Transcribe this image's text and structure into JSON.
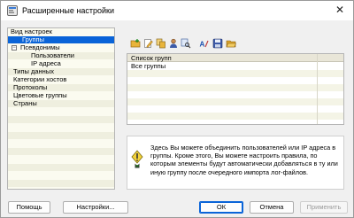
{
  "window": {
    "title": "Расширенные настройки",
    "close_glyph": "✕",
    "icon": "settings-window-icon"
  },
  "tree": {
    "items": [
      {
        "label": "Вид настроек",
        "level": 0,
        "expander": "",
        "selected": false
      },
      {
        "label": "Группы",
        "level": 1,
        "expander": "",
        "selected": true
      },
      {
        "label": "Псевдонимы",
        "level": 0,
        "expander": "−",
        "selected": false
      },
      {
        "label": "Пользователи",
        "level": 2,
        "expander": "",
        "selected": false
      },
      {
        "label": "IP адреса",
        "level": 2,
        "expander": "",
        "selected": false
      },
      {
        "label": "Типы данных",
        "level": 1,
        "expander": "",
        "selected": false
      },
      {
        "label": "Категории хостов",
        "level": 1,
        "expander": "",
        "selected": false
      },
      {
        "label": "Протоколы",
        "level": 1,
        "expander": "",
        "selected": false
      },
      {
        "label": "Цветовые группы",
        "level": 1,
        "expander": "",
        "selected": false
      },
      {
        "label": "Страны",
        "level": 1,
        "expander": "",
        "selected": false
      }
    ]
  },
  "toolbar": {
    "buttons": [
      {
        "name": "add-group-button",
        "icon": "add-folder-icon"
      },
      {
        "name": "edit-group-button",
        "icon": "edit-icon"
      },
      {
        "name": "copy-group-button",
        "icon": "copy-icon"
      },
      {
        "name": "add-user-button",
        "icon": "user-icon"
      },
      {
        "name": "find-button",
        "icon": "search-icon"
      },
      {
        "name": "rename-button",
        "icon": "rename-icon"
      },
      {
        "name": "save-button",
        "icon": "save-icon"
      },
      {
        "name": "open-button",
        "icon": "open-folder-icon"
      }
    ]
  },
  "groups_list": {
    "header": "Список групп",
    "rows": [
      "Все группы"
    ]
  },
  "info": {
    "text": "Здесь Вы можете объединить пользователей или IP адреса в группы. Кроме этого, Вы можете настроить правила, по которым элементы будут автоматически добавляться в ту или иную группу после очередного импорта лог-файлов."
  },
  "buttons": {
    "help": "Помощь",
    "settings": "Настройки...",
    "ok": "ОК",
    "cancel": "Отмена",
    "apply": "Применить"
  },
  "colors": {
    "selection": "#0a64d8",
    "tree_background": "#fbfbf0",
    "stripe": "#efefdf",
    "accent": "#0a64d8"
  }
}
